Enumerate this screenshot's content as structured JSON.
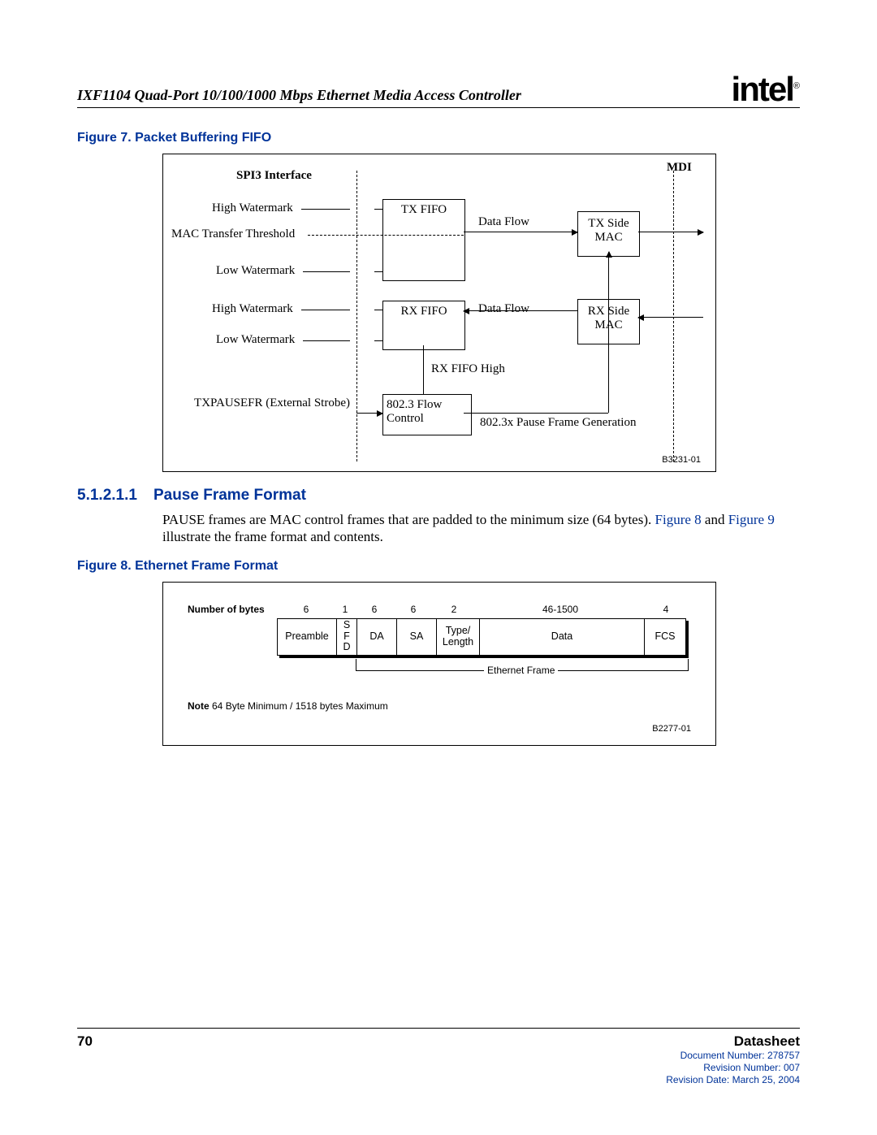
{
  "header": {
    "doc_title": "IXF1104 Quad-Port 10/100/1000 Mbps Ethernet Media Access Controller",
    "logo_text": "intel",
    "logo_r": "®"
  },
  "figure7": {
    "caption": "Figure 7.  Packet Buffering FIFO",
    "labels": {
      "spi3": "SPI3 Interface",
      "mdi": "MDI",
      "hw1": "High Watermark",
      "mtt": "MAC Transfer Threshold",
      "lw1": "Low Watermark",
      "hw2": "High Watermark",
      "lw2": "Low Watermark",
      "txpause": "TXPAUSEFR (External Strobe)",
      "txfifo": "TX FIFO",
      "rxfifo": "RX FIFO",
      "dataflow1": "Data Flow",
      "dataflow2": "Data Flow",
      "txmac": "TX Side MAC",
      "rxmac": "RX Side MAC",
      "flowctl": "802.3 Flow Control",
      "rxfifohigh": "RX FIFO High",
      "pausegen": "802.3x Pause Frame Generation",
      "figid": "B3231-01"
    }
  },
  "section": {
    "num": "5.1.2.1.1",
    "title": "Pause Frame Format",
    "body_a": "PAUSE frames are MAC control frames that are padded to the minimum size (64 bytes). ",
    "figref8": "Figure 8",
    "body_b": " and ",
    "figref9": "Figure 9",
    "body_c": " illustrate the frame format and contents."
  },
  "figure8": {
    "caption": "Figure 8.  Ethernet Frame Format",
    "nob_label": "Number of bytes",
    "bytes": [
      "6",
      "1",
      "6",
      "6",
      "2",
      "46-1500",
      "4"
    ],
    "cells": [
      "Preamble",
      "S\nF\nD",
      "DA",
      "SA",
      "Type/\nLength",
      "Data",
      "FCS"
    ],
    "bracket": "Ethernet Frame",
    "note_b": "Note",
    "note_t": "  64 Byte Minimum / 1518 bytes Maximum",
    "figid": "B2277-01"
  },
  "footer": {
    "page": "70",
    "ds": "Datasheet",
    "docnum": "Document Number: 278757",
    "revnum": "Revision Number: 007",
    "revdate": "Revision Date: March 25, 2004"
  }
}
